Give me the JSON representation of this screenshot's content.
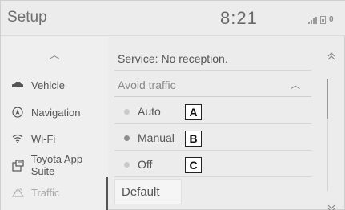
{
  "header": {
    "title": "Setup",
    "clock": "8:21",
    "status_number": "0"
  },
  "sidebar": {
    "scroll_up_icon": "chevron-up-icon",
    "items": [
      {
        "label": "Vehicle",
        "icon": "car-icon",
        "selected": false
      },
      {
        "label": "Navigation",
        "icon": "navigation-icon",
        "selected": false
      },
      {
        "label": "Wi-Fi",
        "icon": "wifi-icon",
        "selected": false
      },
      {
        "label": "Toyota App Suite",
        "icon": "app-suite-icon",
        "selected": false
      },
      {
        "label": "Traffic",
        "icon": "traffic-icon",
        "selected": true
      }
    ]
  },
  "main": {
    "service_status": "Service: No reception.",
    "avoid_traffic": {
      "label": "Avoid traffic",
      "expanded": true,
      "options": [
        {
          "label": "Auto",
          "selected": false,
          "callout": "A"
        },
        {
          "label": "Manual",
          "selected": true,
          "callout": "B"
        },
        {
          "label": "Off",
          "selected": false,
          "callout": "C"
        }
      ]
    },
    "default_button": "Default"
  },
  "scrollbar": {
    "up_icon": "double-chevron-up-icon",
    "down_icon": "double-chevron-down-icon"
  },
  "colors": {
    "background": "#ececec",
    "text": "#555555",
    "muted": "#aaaaaa"
  }
}
